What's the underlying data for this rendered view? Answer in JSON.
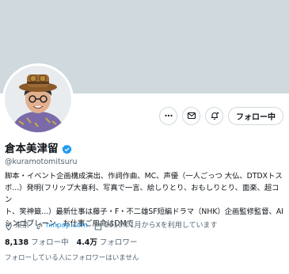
{
  "profile": {
    "display_name": "倉本美津留",
    "handle": "@kuramotomitsuru",
    "bio_lines": [
      "脚本・イベント企画構成演出、作詞作曲、MC、声優（一人ごっつ 大仏、DTDXトス",
      "ポ...）発明(フリップ大喜利、写真で一言、絵しりとり、おもしりとり、面楽、超コン",
      "ト、笑神籤...）最新仕事は藤子・F・不二雄SF短編ドラマ（NHK）企画監修監督、AI",
      "シンゴブレーン。お仕事ご用命はDMで"
    ],
    "location": "東京",
    "website": "ninpop.com",
    "joined": "2010年1月からXを利用しています",
    "following_count": "8,138",
    "following_label": "フォロー中",
    "followers_count": "4.4万",
    "followers_label": "フォロワー",
    "followers_you_know": "フォローしている人にフォロワーはいません"
  },
  "actions": {
    "follow_label": "フォロー中"
  },
  "colors": {
    "banner": "#cfd9de",
    "accent": "#1d9bf0",
    "secondary_text": "#536471"
  },
  "icons": [
    "more-icon",
    "mail-icon",
    "notify-icon",
    "verified-icon",
    "location-icon",
    "link-icon",
    "calendar-icon"
  ]
}
